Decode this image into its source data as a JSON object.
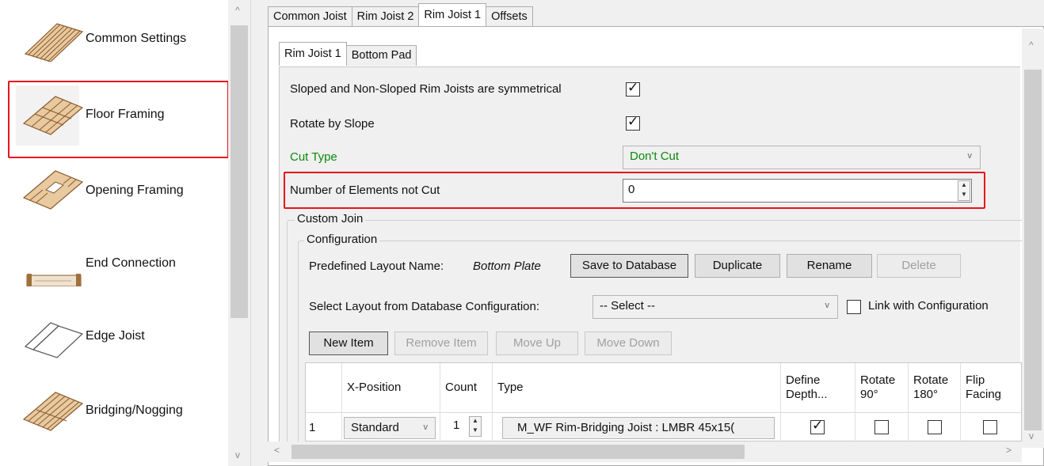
{
  "sidebar": {
    "items": [
      {
        "label": "Common Settings",
        "icon": "common-settings-icon"
      },
      {
        "label": "Floor Framing",
        "icon": "floor-framing-icon"
      },
      {
        "label": "Opening Framing",
        "icon": "opening-framing-icon"
      },
      {
        "label": "End Connection",
        "icon": "end-connection-icon"
      },
      {
        "label": "Edge Joist",
        "icon": "edge-joist-icon"
      },
      {
        "label": "Bridging/Nogging",
        "icon": "bridging-nogging-icon"
      }
    ],
    "selected": "Floor Framing"
  },
  "outer_tabs": [
    "Common Joist",
    "Rim Joist 2",
    "Rim Joist 1",
    "Offsets"
  ],
  "outer_active": "Rim Joist 1",
  "inner_tabs": [
    "Rim Joist 1",
    "Bottom Pad"
  ],
  "inner_active": "Rim Joist 1",
  "settings": {
    "symmetrical_label": "Sloped and Non-Sloped Rim Joists are symmetrical",
    "symmetrical_checked": true,
    "rotate_label": "Rotate by Slope",
    "rotate_checked": true,
    "cut_type_label": "Cut Type",
    "cut_type_value": "Don't Cut",
    "elements_not_cut_label": "Number of Elements not Cut",
    "elements_not_cut_value": "0"
  },
  "custom_join": {
    "title": "Custom Join",
    "configuration_title": "Configuration",
    "predefined_label": "Predefined Layout Name:",
    "predefined_value": "Bottom Plate",
    "buttons": {
      "save": "Save to Database",
      "duplicate": "Duplicate",
      "rename": "Rename",
      "delete": "Delete"
    },
    "select_layout_label": "Select Layout from Database Configuration:",
    "select_layout_value": "-- Select --",
    "link_label": "Link with Configuration",
    "link_checked": false,
    "item_buttons": {
      "new": "New Item",
      "remove": "Remove Item",
      "up": "Move Up",
      "down": "Move Down"
    }
  },
  "table": {
    "headers": {
      "x_position": "X-Position",
      "count": "Count",
      "type": "Type",
      "define_depth": "Define Depth...",
      "rotate90": "Rotate 90°",
      "rotate180": "Rotate 180°",
      "flip": "Flip Facing"
    },
    "rows": [
      {
        "index": "1",
        "x_position": "Standard",
        "count": "1",
        "type": "M_WF Rim-Bridging Joist : LMBR 45x15(",
        "define_depth": true,
        "rotate90": false,
        "rotate180": false,
        "flip": false
      }
    ]
  },
  "colors": {
    "highlight": "#e8141c",
    "green_label": "#0a8a0a"
  }
}
